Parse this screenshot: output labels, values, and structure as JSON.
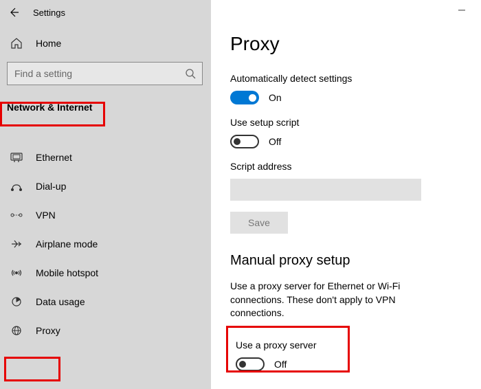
{
  "window": {
    "title": "Settings"
  },
  "sidebar": {
    "home_label": "Home",
    "search_placeholder": "Find a setting",
    "section_title": "Network & Internet",
    "items": [
      {
        "label": "Ethernet"
      },
      {
        "label": "Dial-up"
      },
      {
        "label": "VPN"
      },
      {
        "label": "Airplane mode"
      },
      {
        "label": "Mobile hotspot"
      },
      {
        "label": "Data usage"
      },
      {
        "label": "Proxy"
      }
    ]
  },
  "page": {
    "title": "Proxy",
    "auto_detect_label": "Automatically detect settings",
    "auto_detect_state": "On",
    "use_script_label": "Use setup script",
    "use_script_state": "Off",
    "script_address_label": "Script address",
    "script_address_value": "",
    "save_label": "Save",
    "manual_heading": "Manual proxy setup",
    "manual_desc": "Use a proxy server for Ethernet or Wi-Fi connections. These don't apply to VPN connections.",
    "use_proxy_label": "Use a proxy server",
    "use_proxy_state": "Off"
  }
}
